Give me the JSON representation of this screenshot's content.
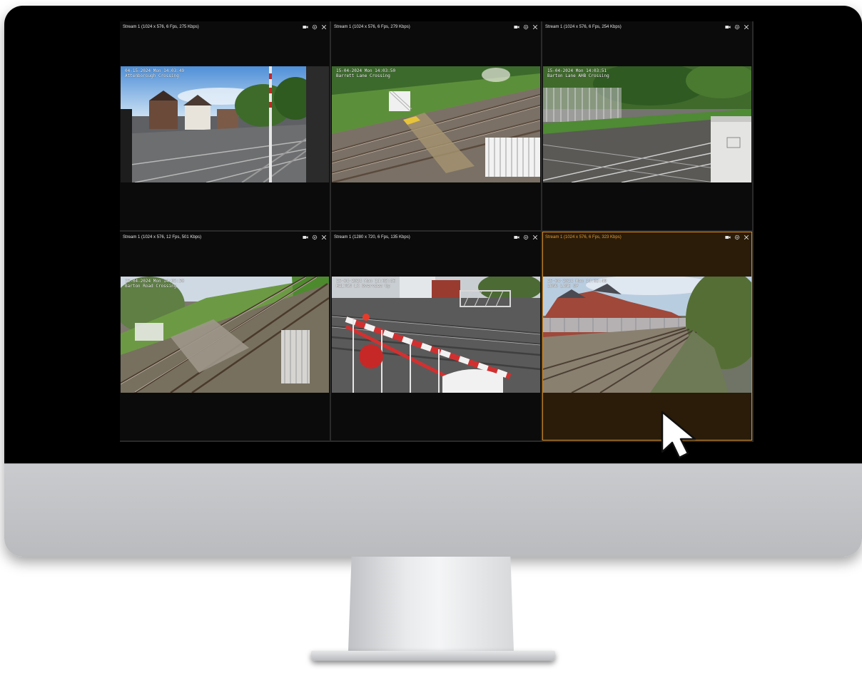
{
  "tiles": [
    {
      "stream_label": "Stream 1 (1024 x 576, 6 Fps, 275 Kbps)",
      "osd_date": "04-15-2024 Mon 14:03:49",
      "osd_name": "Attenborough Crossing",
      "selected": false
    },
    {
      "stream_label": "Stream 1 (1024 x 576, 6 Fps, 279 Kbps)",
      "osd_date": "15-04-2024 Mon 14:03:50",
      "osd_name": "Barrett Lane Crossing",
      "selected": false
    },
    {
      "stream_label": "Stream 1 (1024 x 576, 6 Fps, 254 Kbps)",
      "osd_date": "15-04-2024 Mon 14:03:51",
      "osd_name": "Barton Lane AHB Crossing",
      "selected": false
    },
    {
      "stream_label": "Stream 1 (1024 x 576, 12 Fps, 501 Kbps)",
      "osd_date": "15-04-2024 Mon 14:03:50",
      "osd_name": "Barton Road Crossing",
      "selected": false
    },
    {
      "stream_label": "Stream 1 (1280 x 720, 6 Fps, 135 Kbps)",
      "osd_date": "15-04-2024 Mon 14:03:46",
      "osd_name": "HILTON LX Overview Up",
      "selected": false
    },
    {
      "stream_label": "Stream 1 (1024 x 576, 6 Fps, 323 Kbps)",
      "osd_date": "15-04-2024 Mon 14:03:49",
      "osd_name": "LONG LANE UP",
      "selected": true
    }
  ],
  "icons": {
    "record": "video-camera-icon",
    "settings": "gear-icon",
    "close": "close-icon"
  },
  "colors": {
    "selected_accent": "#d98a1e",
    "tile_bg": "#0b0b0b",
    "screen_bg": "#000000"
  }
}
